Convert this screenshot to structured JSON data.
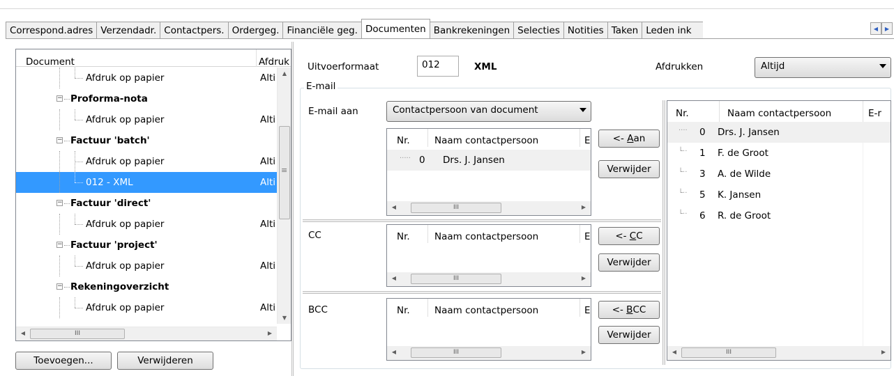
{
  "tabs": [
    {
      "label": "Correspond.adres",
      "active": false
    },
    {
      "label": "Verzendadr.",
      "active": false
    },
    {
      "label": "Contactpers.",
      "active": false
    },
    {
      "label": "Ordergeg.",
      "active": false
    },
    {
      "label": "Financiële geg.",
      "active": false
    },
    {
      "label": "Documenten",
      "active": true
    },
    {
      "label": "Bankrekeningen",
      "active": false
    },
    {
      "label": "Selecties",
      "active": false
    },
    {
      "label": "Notities",
      "active": false
    },
    {
      "label": "Taken",
      "active": false
    },
    {
      "label": "Leden ink",
      "active": false
    }
  ],
  "tree": {
    "col_document": "Document",
    "col_afdruk": "Afdruk",
    "rows": [
      {
        "label": "Afdruk op papier",
        "value": "Alti",
        "level": 1
      },
      {
        "label": "Proforma-nota",
        "value": "",
        "level": 0
      },
      {
        "label": "Afdruk op papier",
        "value": "Alti",
        "level": 1
      },
      {
        "label": "Factuur 'batch'",
        "value": "",
        "level": 0
      },
      {
        "label": "Afdruk op papier",
        "value": "Alti",
        "level": 1
      },
      {
        "label": "012 - XML",
        "value": "Alti",
        "level": 1,
        "selected": true
      },
      {
        "label": "Factuur 'direct'",
        "value": "",
        "level": 0
      },
      {
        "label": "Afdruk op papier",
        "value": "Alti",
        "level": 1
      },
      {
        "label": "Factuur 'project'",
        "value": "",
        "level": 0
      },
      {
        "label": "Afdruk op papier",
        "value": "Alti",
        "level": 1
      },
      {
        "label": "Rekeningoverzicht",
        "value": "",
        "level": 0
      },
      {
        "label": "Afdruk op papier",
        "value": "Alti",
        "level": 1
      }
    ],
    "add_button": "Toevoegen...",
    "remove_button": "Verwijderen",
    "hscroll_grip": "III",
    "vscroll_grip": "≡"
  },
  "format": {
    "label": "Uitvoerformaat",
    "code": "012",
    "name": "XML",
    "print_label": "Afdrukken",
    "print_value": "Altijd"
  },
  "email": {
    "group_title": "E-mail",
    "to_label": "E-mail aan",
    "to_value": "Contactpersoon van document",
    "col_nr": "Nr.",
    "col_name": "Naam contactpersoon",
    "col_e": "E",
    "col_e_right": "E-r",
    "to_rows": [
      {
        "nr": "0",
        "name": "Drs. J. Jansen"
      }
    ],
    "cc_label": "CC",
    "bcc_label": "BCC",
    "btn_to_prefix": "<- ",
    "btn_to_key": "A",
    "btn_to_rest": "an",
    "btn_cc_prefix": "<- ",
    "btn_cc_key": "C",
    "btn_cc_rest": "C",
    "btn_bcc_prefix": "<- ",
    "btn_bcc_key": "B",
    "btn_bcc_rest": "CC",
    "remove": "Verwijder",
    "contacts": [
      {
        "nr": "0",
        "name": "Drs. J. Jansen"
      },
      {
        "nr": "1",
        "name": "F. de Groot"
      },
      {
        "nr": "3",
        "name": "A. de Wilde"
      },
      {
        "nr": "5",
        "name": "K. Jansen"
      },
      {
        "nr": "6",
        "name": "R. de Groot"
      }
    ],
    "hscroll_grip": "III"
  },
  "colors": {
    "selection": "#3399ff",
    "border": "#828790"
  }
}
